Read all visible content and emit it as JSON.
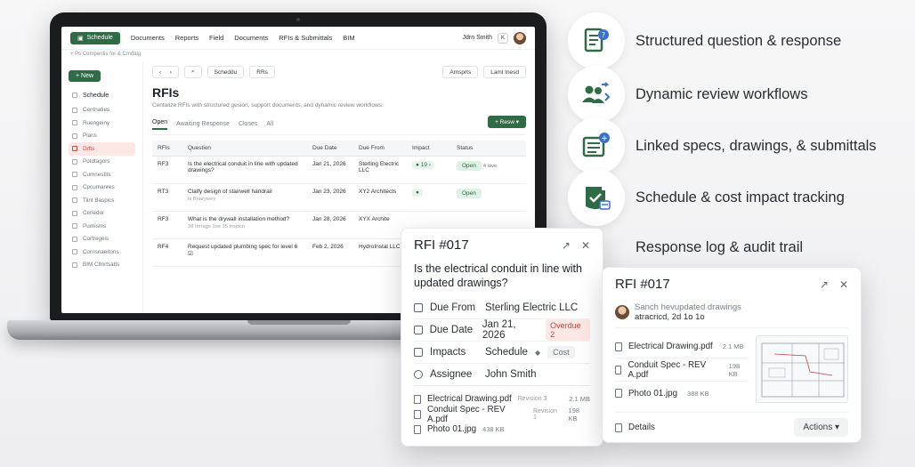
{
  "app": {
    "topnav": {
      "schedule_btn": "Schedule",
      "items": [
        "Documents",
        "Reports",
        "Field",
        "Documents",
        "RFIs & Submittals",
        "BIM"
      ],
      "user_name": "Jdrn Smith",
      "user_tag": "K"
    },
    "breadcrumb": "+  Ps Compentis for & Cmdalg",
    "sidebar": {
      "new_btn": "+ New",
      "items": [
        "Schedule",
        "Centnaties",
        "Ruengeiny",
        "Plans",
        "Drfts",
        "Potdtagors",
        "Cumnestits",
        "Cpcumanres",
        "Tiint Baspics",
        "Cerledor",
        "Purnisms",
        "Cortregeis",
        "Cornsnaeitons",
        "BIM Cltnrtsatts"
      ]
    },
    "toolbar": {
      "nav_prev": "‹",
      "nav_next": "›",
      "search_icon": "⌕",
      "pill1": "Scheddu",
      "pill2": "RRs",
      "right1": "Amsprts",
      "right2": "Laml Inesd"
    },
    "title": "RFIs",
    "subtitle": "Centalize RFIs with structured gesion, support documents, and dynamic review workflows.",
    "tabs": [
      "Open",
      "Awaiting Response",
      "Closes",
      "All"
    ],
    "new_rfi": "+ Resw  ▾",
    "table": {
      "headers": [
        "RFIs",
        "Question",
        "Due Date",
        "Due From",
        "Impact",
        "Status"
      ],
      "rows": [
        {
          "id": "RF3",
          "q": "Is the electrical conduit in line with updated drawings?",
          "sub": "",
          "due": "Jan 21, 2026",
          "from": "Sterling Electric LLC",
          "impact": "● 19 ›",
          "status": "Open",
          "extra": "4 lave"
        },
        {
          "id": "RT3",
          "q": "Clalfy design of stairwell handrail",
          "sub": "is Briarywey",
          "due": "Jan 23, 2026",
          "from": "XY2 Architects",
          "impact": "●",
          "status": "Open",
          "extra": ""
        },
        {
          "id": "RF3",
          "q": "What is the drywall installation method?",
          "sub": "38 Imrags 1oe 15 tropicn",
          "due": "Jan 28, 2026",
          "from": "XYX Archite",
          "impact": "",
          "status": "",
          "extra": ""
        },
        {
          "id": "RF4",
          "q": "Request updated plumbing spec for level 6 ☑",
          "sub": "",
          "due": "Feb 2, 2026",
          "from": "HydroInstal LLC",
          "impact": "",
          "status": "",
          "extra": ""
        }
      ]
    }
  },
  "features": [
    {
      "label": "Structured question & response",
      "icon": "document-question-icon"
    },
    {
      "label": "Dynamic review workflows",
      "icon": "users-workflow-icon"
    },
    {
      "label": "Linked specs, drawings, & submittals",
      "icon": "linked-document-icon"
    },
    {
      "label": "Schedule & cost impact tracking",
      "icon": "clipboard-check-icon"
    },
    {
      "label": "Response log & audit trail",
      "icon": "log-icon"
    }
  ],
  "popup1": {
    "title": "RFI #017",
    "question": "Is the electrical conduit in line with updated drawings?",
    "due_from_label": "Due From",
    "due_from": "Sterling Electric LLC",
    "due_date_label": "Due Date",
    "due_date": "Jan 21, 2026",
    "overdue": "Overdue  2",
    "impacts_label": "Impacts",
    "impacts_value": "Schedule",
    "impacts_cost": "Cost",
    "assignee_label": "Assignee",
    "assignee": "John Smith",
    "files": [
      {
        "name": "Electrical Drawing.pdf",
        "meta": "Revision 3",
        "size": "2.1 MB"
      },
      {
        "name": "Conduit Spec - REV A.pdf",
        "meta": "Revision 1",
        "size": "198 KB"
      },
      {
        "name": "Photo 01.jpg",
        "meta": "",
        "size": "438 KB"
      }
    ]
  },
  "popup2": {
    "title": "RFI #017",
    "comment_line1": "Sanch hevupdated drawings",
    "comment_line2": "atracricd, 2d 1o 1o",
    "files": [
      {
        "name": "Electrical Drawing.pdf",
        "size": "2.1 MB"
      },
      {
        "name": "Conduit Spec - REV A.pdf",
        "size": "198 KB"
      },
      {
        "name": "Photo 01.jpg",
        "size": "388 KB"
      }
    ],
    "details": "Details",
    "actions": "Actions  ▾"
  }
}
